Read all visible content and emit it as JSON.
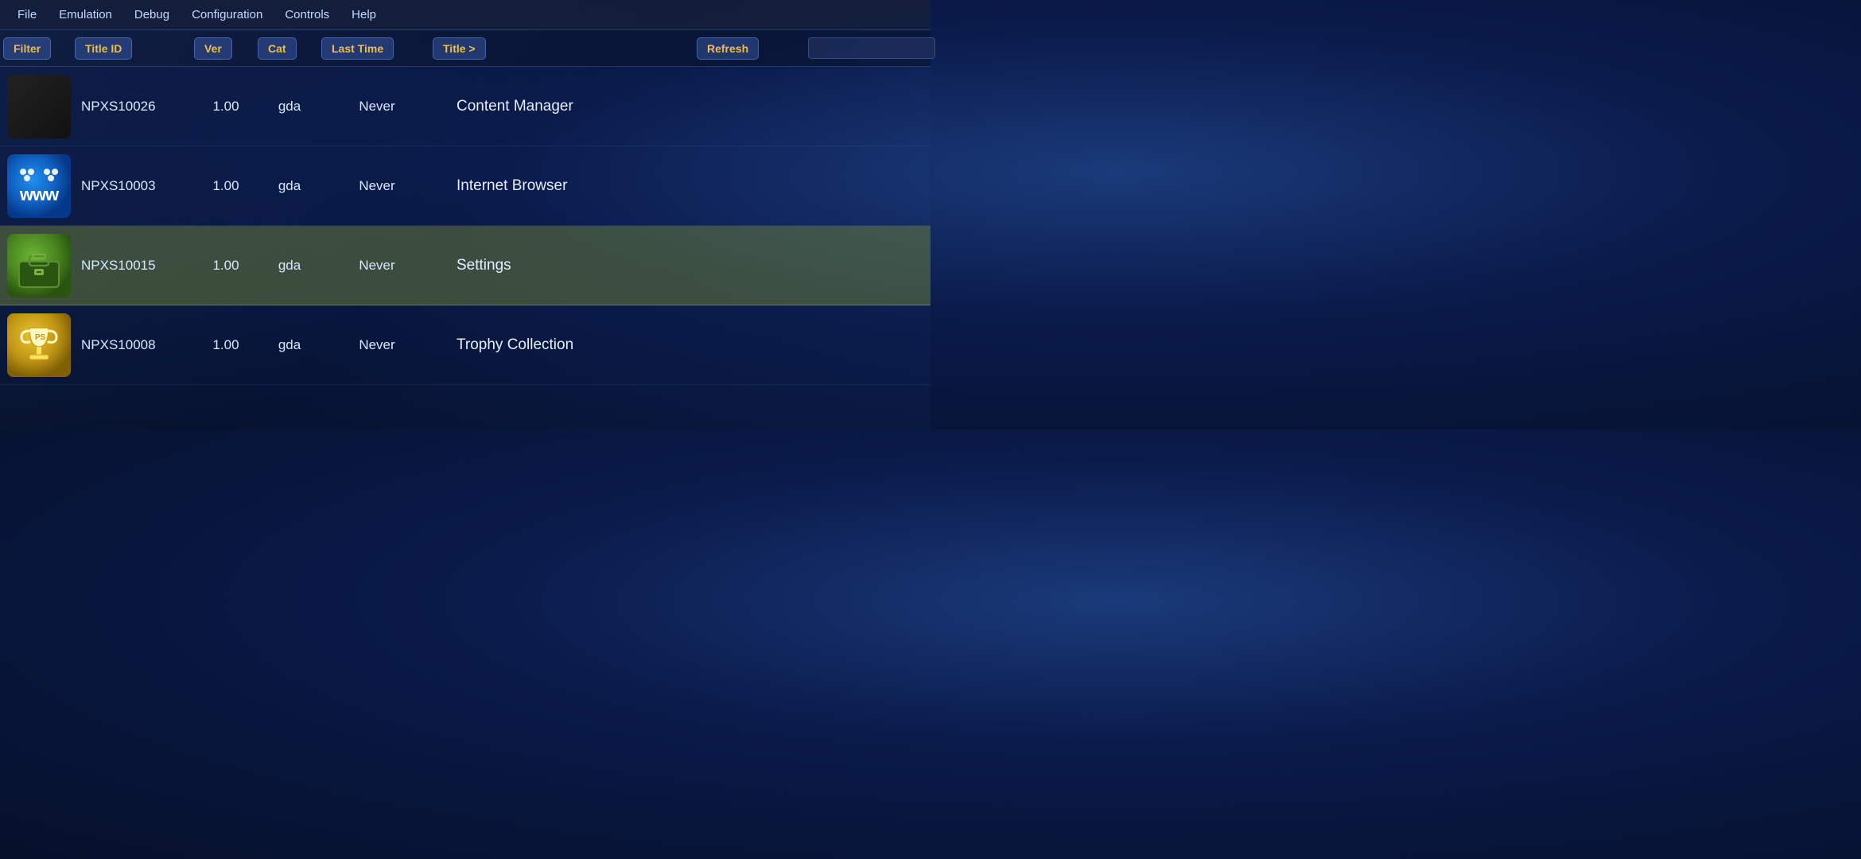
{
  "menubar": {
    "items": [
      "File",
      "Emulation",
      "Debug",
      "Configuration",
      "Controls",
      "Help"
    ]
  },
  "header": {
    "filter_label": "Filter",
    "titleid_label": "Title ID",
    "ver_label": "Ver",
    "cat_label": "Cat",
    "lasttime_label": "Last Time",
    "title_label": "Title >",
    "refresh_label": "Refresh",
    "search_placeholder": ""
  },
  "rows": [
    {
      "id": "row-content-manager",
      "titleid": "NPXS10026",
      "ver": "1.00",
      "cat": "gda",
      "lasttime": "Never",
      "title": "Content Manager",
      "icon_type": "content-manager",
      "selected": false
    },
    {
      "id": "row-internet-browser",
      "titleid": "NPXS10003",
      "ver": "1.00",
      "cat": "gda",
      "lasttime": "Never",
      "title": "Internet Browser",
      "icon_type": "browser",
      "selected": false
    },
    {
      "id": "row-settings",
      "titleid": "NPXS10015",
      "ver": "1.00",
      "cat": "gda",
      "lasttime": "Never",
      "title": "Settings",
      "icon_type": "settings",
      "selected": true
    },
    {
      "id": "row-trophy-collection",
      "titleid": "NPXS10008",
      "ver": "1.00",
      "cat": "gda",
      "lasttime": "Never",
      "title": "Trophy Collection",
      "icon_type": "trophy",
      "selected": false
    }
  ],
  "colors": {
    "accent": "#f0c040",
    "selected_bg": "rgba(110,130,55,0.5)",
    "menu_bg": "rgba(20,30,60,0.92)"
  }
}
